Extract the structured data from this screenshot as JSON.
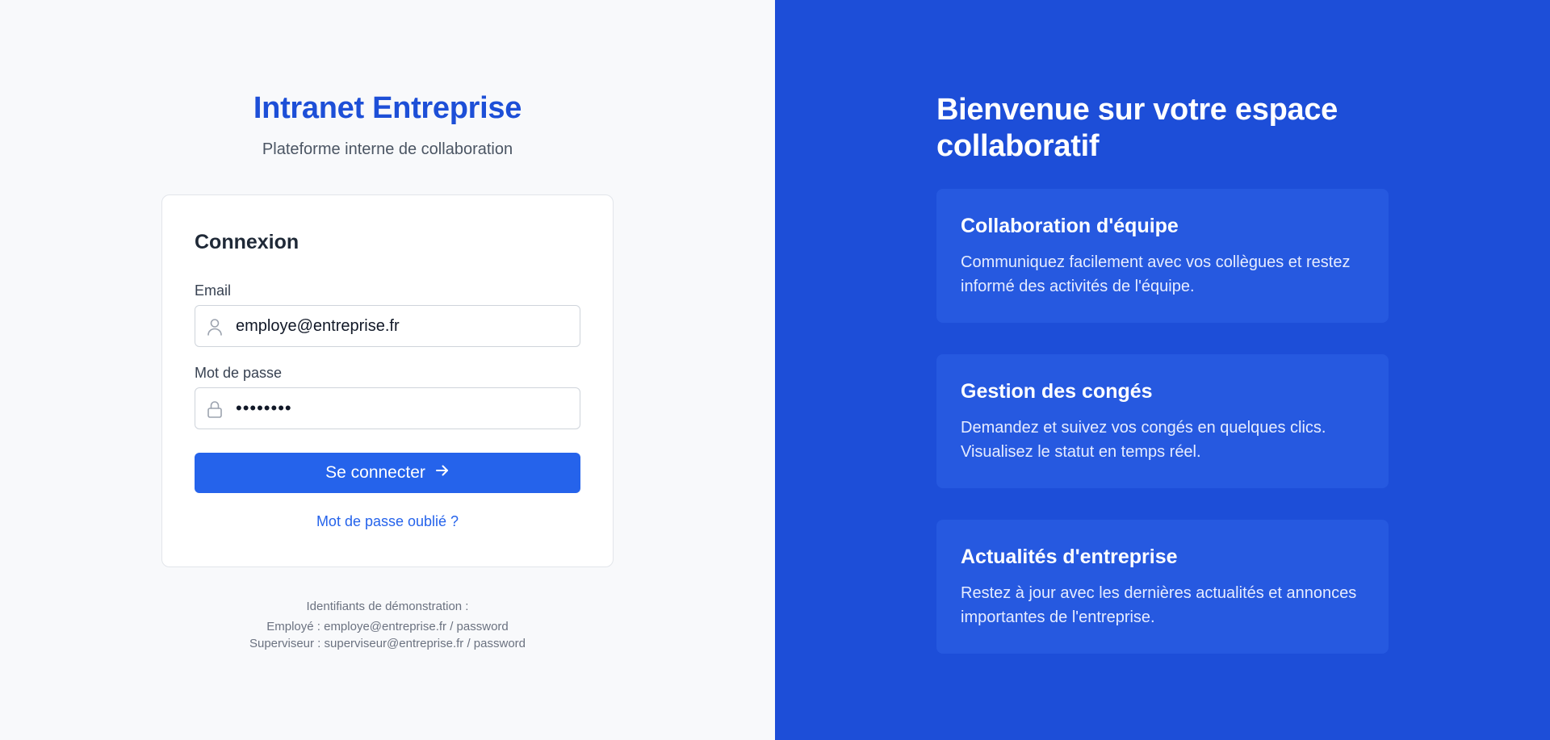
{
  "login": {
    "brand_title": "Intranet Entreprise",
    "brand_subtitle": "Plateforme interne de collaboration",
    "card_title": "Connexion",
    "email_label": "Email",
    "email_value": "employe@entreprise.fr",
    "email_icon": "user-icon",
    "password_label": "Mot de passe",
    "password_value": "••••••••",
    "password_icon": "lock-icon",
    "submit_label": "Se connecter",
    "submit_icon": "arrow-right-icon",
    "forgot_link": "Mot de passe oublié ?"
  },
  "demo_credentials": {
    "heading": "Identifiants de démonstration :",
    "employee": "Employé : employe@entreprise.fr / password",
    "supervisor": "Superviseur : superviseur@entreprise.fr / password"
  },
  "hero": {
    "title": "Bienvenue sur votre espace collaboratif",
    "features": [
      {
        "title": "Collaboration d'équipe",
        "description": "Communiquez facilement avec vos collègues et restez informé des activités de l'équipe."
      },
      {
        "title": "Gestion des congés",
        "description": "Demandez et suivez vos congés en quelques clics. Visualisez le statut en temps réel."
      },
      {
        "title": "Actualités d'entreprise",
        "description": "Restez à jour avec les dernières actualités et annonces importantes de l'entreprise."
      }
    ]
  },
  "colors": {
    "brand_blue": "#1d4fd7",
    "button_blue": "#2563eb",
    "right_panel_bg": "#1d4ed8",
    "feature_card_bg": "#2659e0",
    "left_panel_bg": "#f8f9fb"
  }
}
